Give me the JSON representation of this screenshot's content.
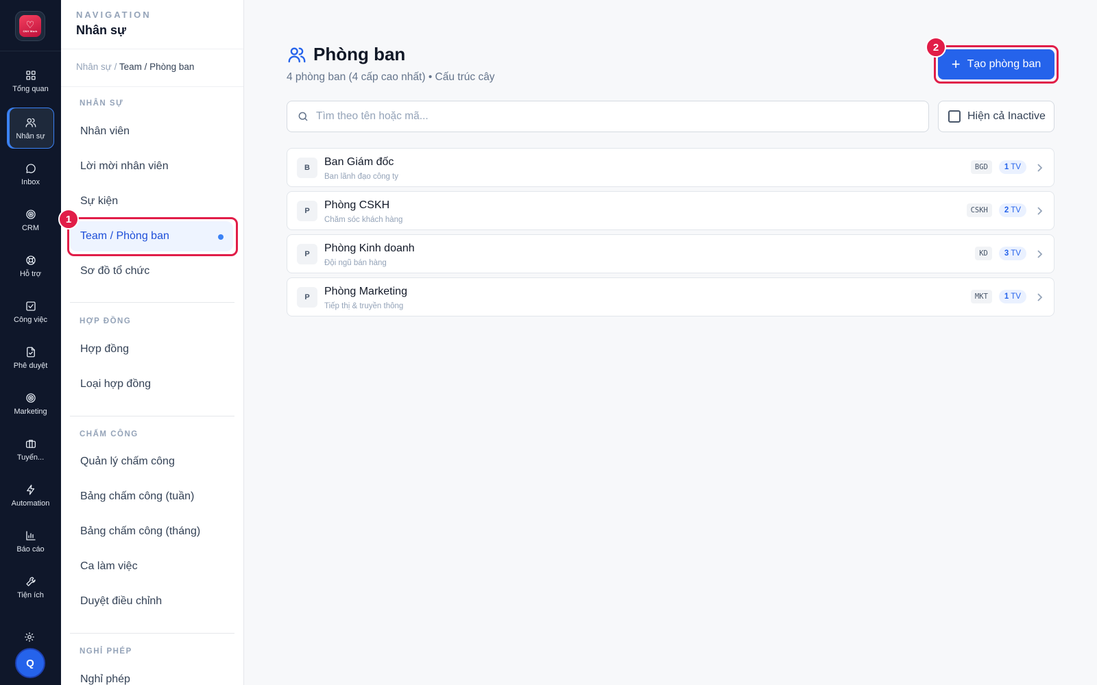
{
  "rail": {
    "logo_text": "CNV Work",
    "items": [
      {
        "label": "Tổng quan",
        "icon": "grid-icon"
      },
      {
        "label": "Nhân sự",
        "icon": "users-icon"
      },
      {
        "label": "Inbox",
        "icon": "chat-icon"
      },
      {
        "label": "CRM",
        "icon": "target-icon"
      },
      {
        "label": "Hỗ trợ",
        "icon": "lifebuoy-icon"
      },
      {
        "label": "Công việc",
        "icon": "checkbox-icon"
      },
      {
        "label": "Phê duyệt",
        "icon": "file-check-icon"
      },
      {
        "label": "Marketing",
        "icon": "target-icon"
      },
      {
        "label": "Tuyển...",
        "icon": "briefcase-icon"
      },
      {
        "label": "Automation",
        "icon": "bolt-icon"
      },
      {
        "label": "Báo cáo",
        "icon": "bar-chart-icon"
      },
      {
        "label": "Tiện ích",
        "icon": "wrench-icon"
      }
    ],
    "settings_icon": "gear-icon",
    "avatar_initial": "Q"
  },
  "subnav": {
    "eyebrow": "NAVIGATION",
    "title": "Nhân sự",
    "breadcrumb": {
      "parent": "Nhân sự",
      "separator": "/",
      "current": "Team / Phòng ban"
    },
    "sections": [
      {
        "label": "NHÂN SỰ",
        "items": [
          "Nhân viên",
          "Lời mời nhân viên",
          "Sự kiện",
          "Team / Phòng ban",
          "Sơ đồ tổ chức"
        ]
      },
      {
        "label": "HỢP ĐỒNG",
        "items": [
          "Hợp đồng",
          "Loại hợp đồng"
        ]
      },
      {
        "label": "CHẤM CÔNG",
        "items": [
          "Quản lý chấm công",
          "Bảng chấm công (tuần)",
          "Bảng chấm công (tháng)",
          "Ca làm việc",
          "Duyệt điều chỉnh"
        ]
      },
      {
        "label": "NGHỈ PHÉP",
        "items": [
          "Nghỉ phép"
        ]
      }
    ]
  },
  "annotations": {
    "badge1": "1",
    "badge2": "2"
  },
  "main": {
    "title": "Phòng ban",
    "subtitle": "4 phòng ban (4 cấp cao nhất) • Cấu trúc cây",
    "create_button": "Tạo phòng ban",
    "search_placeholder": "Tìm theo tên hoặc mã...",
    "show_inactive_label": "Hiện cả Inactive",
    "show_inactive_checked": false,
    "departments": [
      {
        "initial": "B",
        "name": "Ban Giám đốc",
        "desc": "Ban lãnh đạo công ty",
        "code": "BGD",
        "count": "1",
        "unit": "TV"
      },
      {
        "initial": "P",
        "name": "Phòng CSKH",
        "desc": "Chăm sóc khách hàng",
        "code": "CSKH",
        "count": "2",
        "unit": "TV"
      },
      {
        "initial": "P",
        "name": "Phòng Kinh doanh",
        "desc": "Đội ngũ bán hàng",
        "code": "KD",
        "count": "3",
        "unit": "TV"
      },
      {
        "initial": "P",
        "name": "Phòng Marketing",
        "desc": "Tiếp thị & truyền thông",
        "code": "MKT",
        "count": "1",
        "unit": "TV"
      }
    ]
  },
  "colors": {
    "accent": "#2563eb",
    "rail_bg": "#0f172a",
    "highlight": "#e11d48"
  }
}
